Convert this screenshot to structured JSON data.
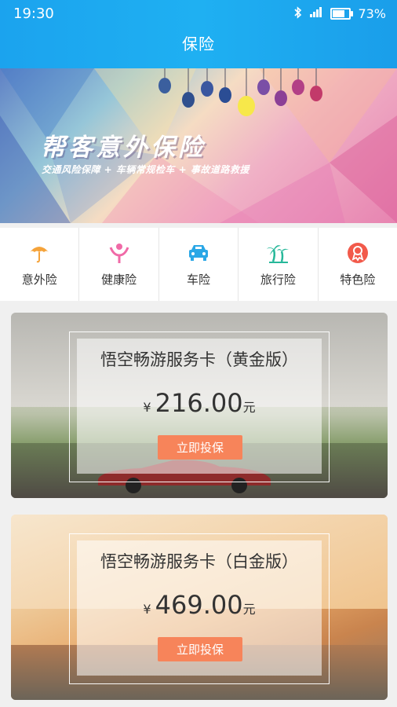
{
  "status_bar": {
    "time": "19:30",
    "battery_percent": "73%",
    "battery_level": 0.73
  },
  "header": {
    "title": "保险"
  },
  "banner": {
    "title": "帮客意外保险",
    "subtitle": "交通风险保障 + 车辆常规检车 + 事故道路救援"
  },
  "categories": [
    {
      "label": "意外险",
      "icon": "umbrella-icon",
      "color": "#f5a33a"
    },
    {
      "label": "健康险",
      "icon": "health-person-icon",
      "color": "#f06aa7"
    },
    {
      "label": "车险",
      "icon": "car-icon",
      "color": "#2aa7e6"
    },
    {
      "label": "旅行险",
      "icon": "palm-tree-icon",
      "color": "#27b89a"
    },
    {
      "label": "特色险",
      "icon": "badge-icon",
      "color": "#f25a4b"
    }
  ],
  "products": [
    {
      "title": "悟空畅游服务卡（黄金版）",
      "currency": "¥",
      "price": "216.00",
      "unit": "元",
      "button": "立即投保"
    },
    {
      "title": "悟空畅游服务卡（白金版）",
      "currency": "¥",
      "price": "469.00",
      "unit": "元",
      "button": "立即投保"
    }
  ],
  "colors": {
    "header": "#1ba3ee",
    "button": "#f7845a"
  }
}
